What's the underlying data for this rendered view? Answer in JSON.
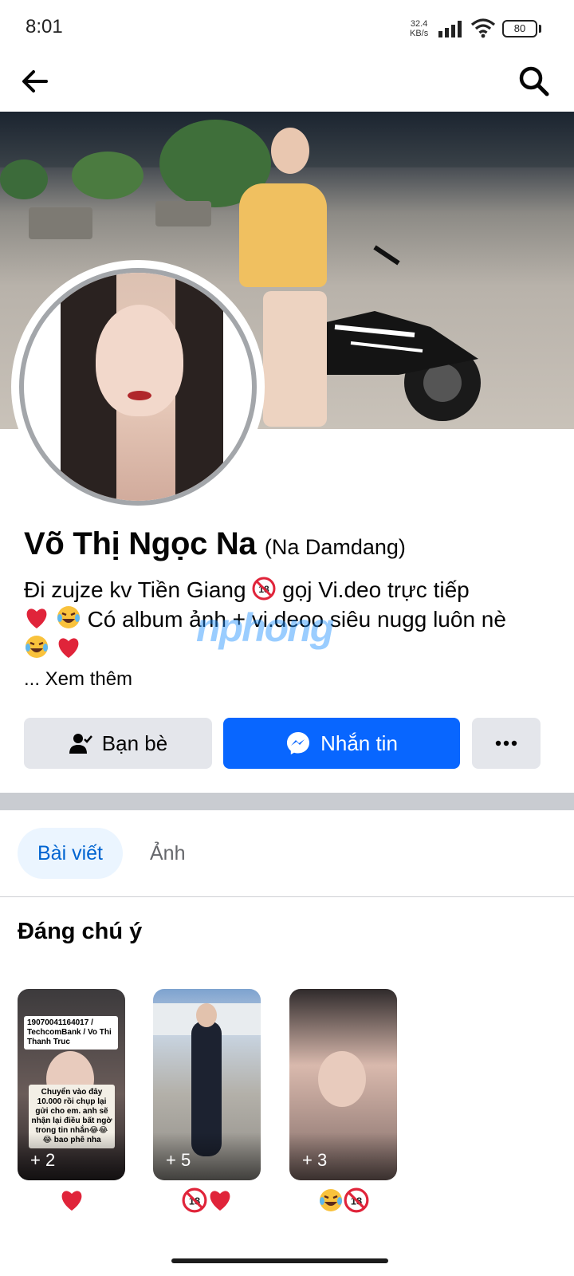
{
  "status_bar": {
    "time": "8:01",
    "net_speed_value": "32.4",
    "net_speed_unit": "KB/s",
    "battery": "80"
  },
  "nav": {
    "back_icon": "arrow-left-icon",
    "search_icon": "search-icon"
  },
  "profile": {
    "name": "Võ Thị Ngọc Na",
    "alternate_name": "(Na Damdang)",
    "bio_line1": "Đi zujze kv Tiền Giang",
    "bio_line1b": "gọj Vi.deo trực tiếp",
    "bio_line2": "Có album ảnh + vi.deoo siêu nugg luôn nè",
    "see_more": "... Xem thêm",
    "watermark": "nphong"
  },
  "actions": {
    "friends_label": "Bạn bè",
    "message_label": "Nhắn tin",
    "more_label": "•••"
  },
  "tabs": [
    {
      "label": "Bài viết",
      "active": true
    },
    {
      "label": "Ảnh",
      "active": false
    }
  ],
  "featured": {
    "title": "Đáng chú ý",
    "cards": [
      {
        "count": "+ 2",
        "note_top": "19070041164017 / TechcomBank / Vo Thi Thanh Truc",
        "note_bottom": "Chuyển vào đây 10.000 rồi chụp lại gửi cho em. anh sẽ nhận lại điều bất ngờ trong tin nhắn😂😂😂 bao phê nha",
        "label_emoji": "❤️"
      },
      {
        "count": "+ 5",
        "label_emoji": "🔞❤️"
      },
      {
        "count": "+ 3",
        "label_emoji": "😂🔞"
      }
    ]
  },
  "colors": {
    "primary": "#0866ff",
    "secondary_button": "#e4e6eb",
    "tab_active_bg": "#ebf5ff",
    "tab_active_text": "#0064d1",
    "separator": "#c9ccd1"
  }
}
